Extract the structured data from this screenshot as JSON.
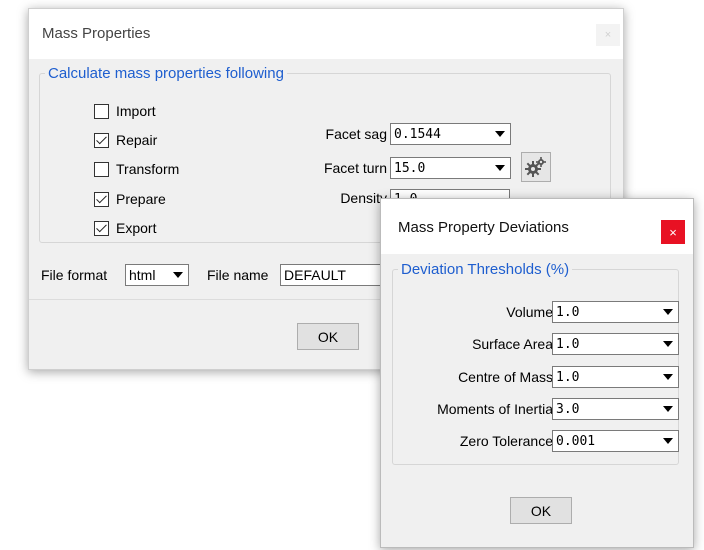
{
  "mass_properties": {
    "title": "Mass Properties",
    "close_glyph": "×",
    "group_title": "Calculate mass properties following",
    "checkboxes": [
      {
        "label": "Import",
        "checked": false
      },
      {
        "label": "Repair",
        "checked": true
      },
      {
        "label": "Transform",
        "checked": false
      },
      {
        "label": "Prepare",
        "checked": true
      },
      {
        "label": "Export",
        "checked": true
      }
    ],
    "facet_sag": {
      "label": "Facet sag",
      "value": "0.1544"
    },
    "facet_turn": {
      "label": "Facet turn",
      "value": "15.0"
    },
    "density": {
      "label": "Density",
      "value": "1.0"
    },
    "settings_icon": "gears-icon",
    "file_format": {
      "label": "File format",
      "value": "html"
    },
    "file_name": {
      "label": "File name",
      "value": "DEFAULT"
    },
    "ok_label": "OK"
  },
  "deviations": {
    "title": "Mass Property Deviations",
    "close_glyph": "×",
    "close_color": "#e81123",
    "group_title": "Deviation Thresholds (%)",
    "rows": [
      {
        "label": "Volume",
        "value": "1.0"
      },
      {
        "label": "Surface Area",
        "value": "1.0"
      },
      {
        "label": "Centre of Mass",
        "value": "1.0"
      },
      {
        "label": "Moments of Inertia",
        "value": "3.0"
      },
      {
        "label": "Zero Tolerance",
        "value": "0.001"
      }
    ],
    "ok_label": "OK"
  }
}
